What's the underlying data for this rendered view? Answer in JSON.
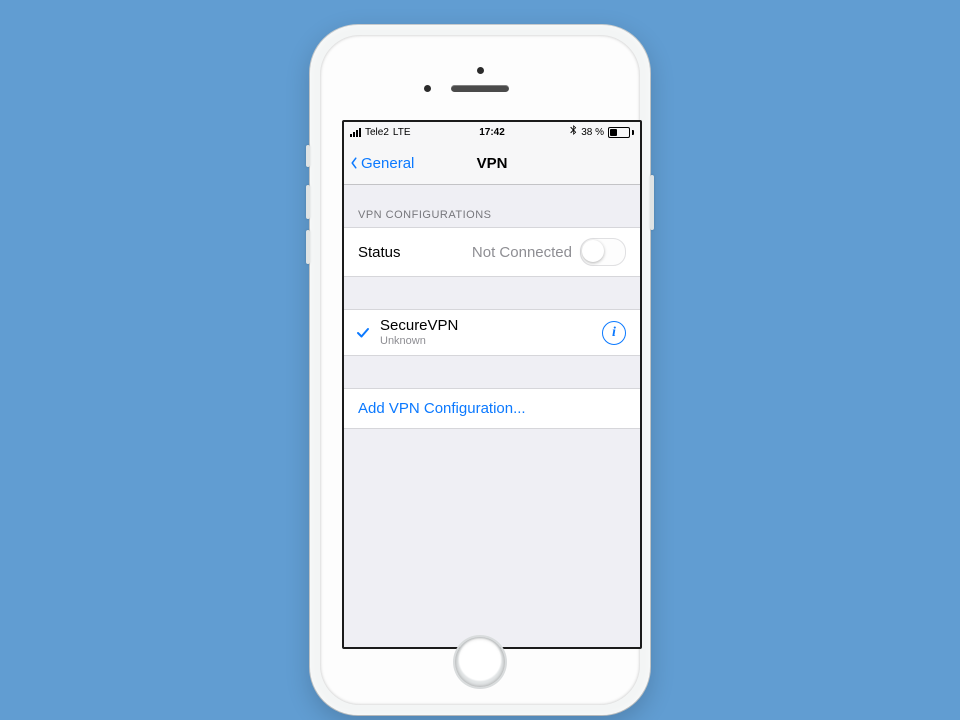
{
  "statusbar": {
    "carrier": "Tele2",
    "network": "LTE",
    "time": "17:42",
    "battery_text": "38 %"
  },
  "nav": {
    "back_label": "General",
    "title": "VPN"
  },
  "section_header": "VPN CONFIGURATIONS",
  "status_row": {
    "label": "Status",
    "value": "Not Connected"
  },
  "config": {
    "name": "SecureVPN",
    "subtitle": "Unknown"
  },
  "add_row": {
    "label": "Add VPN Configuration..."
  }
}
